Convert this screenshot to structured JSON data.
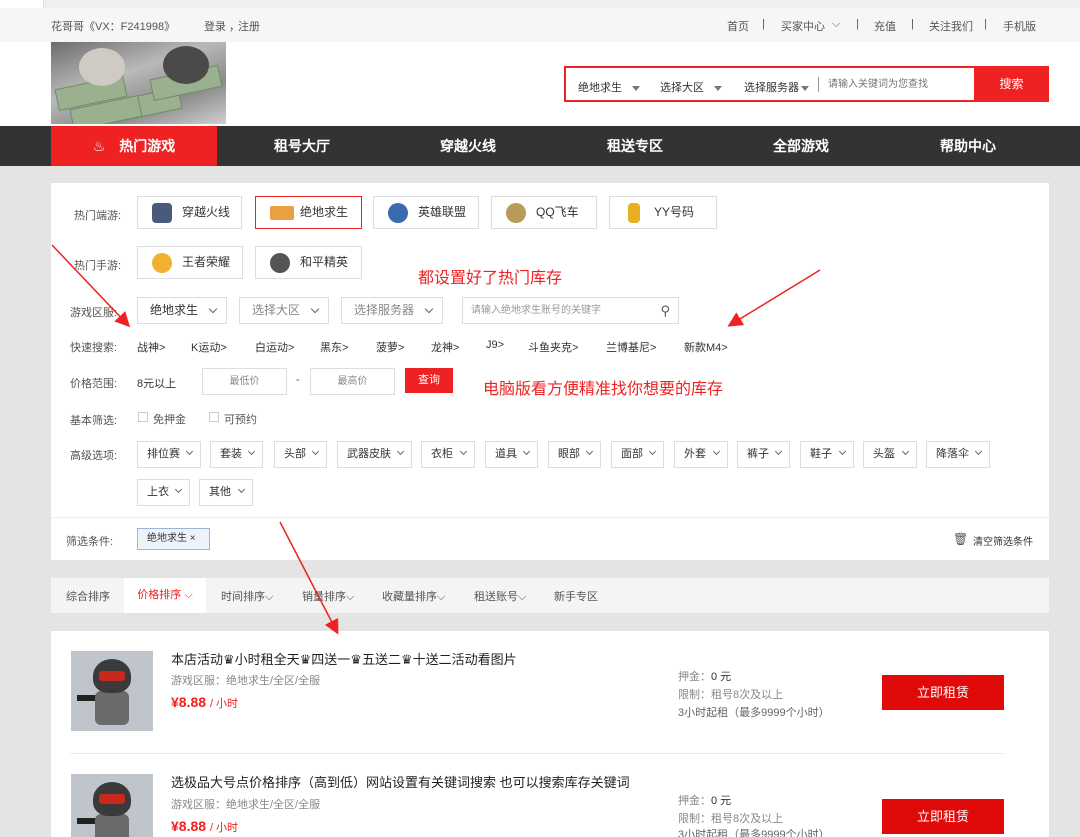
{
  "topbar": {
    "left_text": "花哥哥《VX：F241998》",
    "login": "登录",
    "comma": "，",
    "register": "注册",
    "links": [
      "首页",
      "买家中心",
      "充值",
      "关注我们",
      "手机版"
    ],
    "sep": "|"
  },
  "search": {
    "zone": "绝地求生",
    "region": "选择大区",
    "server": "选择服务器",
    "placeholder": "请输入关键词为您查找",
    "button": "搜索"
  },
  "nav": [
    "热门游戏",
    "租号大厅",
    "穿越火线",
    "租送专区",
    "全部游戏",
    "帮助中心"
  ],
  "filters": {
    "hot_pc_label": "热门端游:",
    "hot_pc": [
      "穿越火线",
      "绝地求生",
      "英雄联盟",
      "QQ飞车",
      "YY号码"
    ],
    "hot_mobile_label": "热门手游:",
    "hot_mobile": [
      "王者荣耀",
      "和平精英"
    ],
    "zone_label": "游戏区服:",
    "zone_value": "绝地求生",
    "region_ph": "选择大区",
    "server_ph": "选择服务器",
    "account_ph": "请输入绝地求生账号的关键字",
    "quick_label": "快速搜索:",
    "quick": [
      "战神>",
      "K运动>",
      "白运动>",
      "黑东>",
      "菠萝>",
      "龙神>",
      "J9>",
      "斗鱼夹克>",
      "兰博基尼>",
      "新款M4>"
    ],
    "price_label": "价格范围:",
    "price_prefix": "8元以上",
    "min_ph": "最低价",
    "dash": "-",
    "max_ph": "最高价",
    "query": "查询",
    "basic_label": "基本筛选:",
    "basic": [
      "免押金",
      "可预约"
    ],
    "adv_label": "高级选项:",
    "adv": [
      "排位赛",
      "套装",
      "头部",
      "武器皮肤",
      "衣柜",
      "道具",
      "眼部",
      "面部",
      "外套",
      "裤子",
      "鞋子",
      "头盔",
      "降落伞",
      "上衣",
      "其他"
    ],
    "cond_label": "筛选条件:",
    "cond_tag": "绝地求生 ×",
    "clear": "清空筛选条件"
  },
  "sort": [
    "综合排序",
    "价格排序",
    "时间排序",
    "销量排序",
    "收藏量排序",
    "租送账号",
    "新手专区"
  ],
  "listings": [
    {
      "title": "本店活动♛小时租全天♛四送一♛五送二♛十送二活动看图片",
      "zone": "游戏区服：绝地求生/全区/全服",
      "price": "¥8.88",
      "unit": "/ 小时",
      "deposit": "押金：",
      "deposit_val": "0 元",
      "limit": "限制：租号8次及以上",
      "min": "3小时起租（最多9999个小时）",
      "button": "立即租赁"
    },
    {
      "title": "选极品大号点价格排序（高到低）网站设置有关键词搜索 也可以搜索库存关键词",
      "zone": "游戏区服：绝地求生/全区/全服",
      "price": "¥8.88",
      "unit": "/ 小时",
      "deposit": "押金：",
      "deposit_val": "0 元",
      "limit": "限制：租号8次及以上",
      "min": "3小时起租（最多9999个小时）",
      "button": "立即租赁"
    }
  ],
  "annotations": [
    "都设置好了热门库存",
    "电脑版看方便精准找你想要的库存"
  ],
  "colors": {
    "accent": "#e22222",
    "nav_bg": "#333333"
  }
}
